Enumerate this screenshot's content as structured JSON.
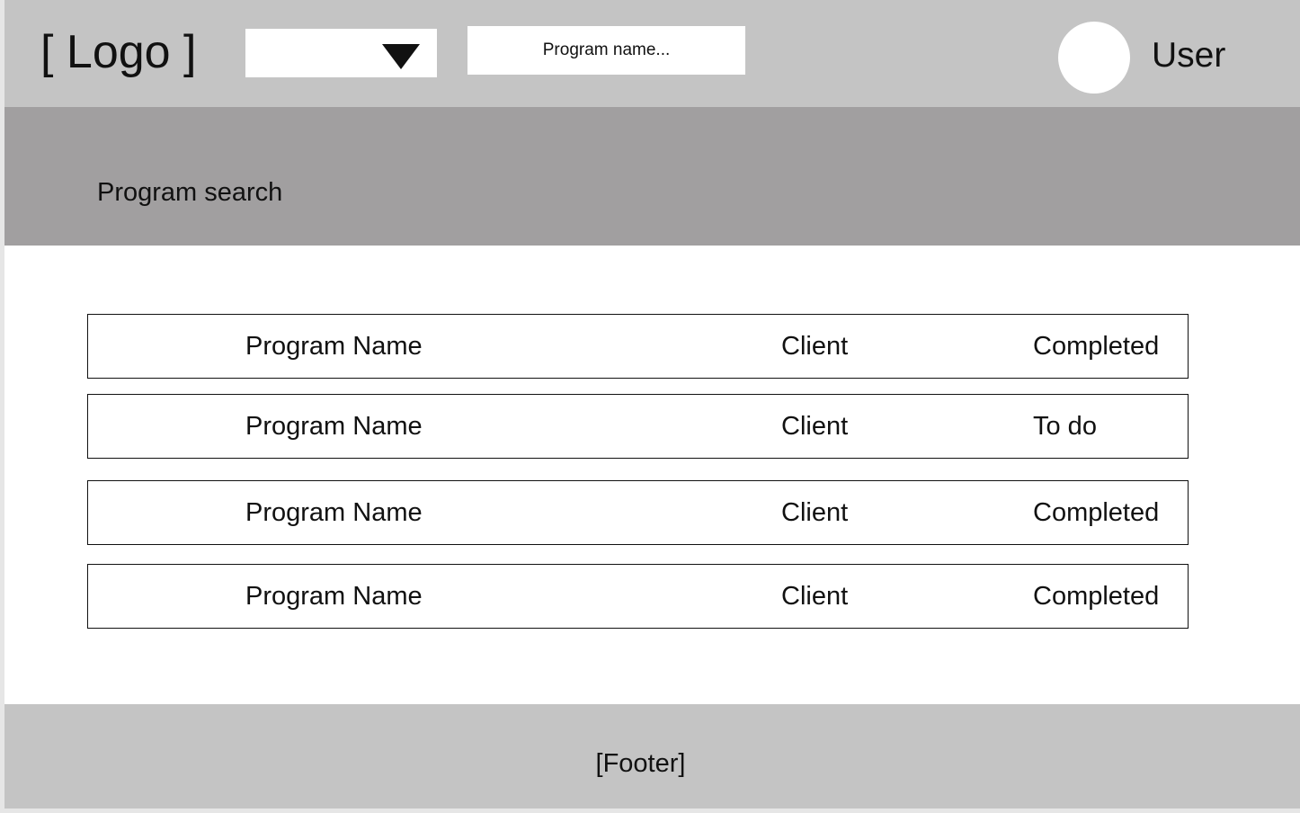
{
  "header": {
    "logo_text": "[ Logo ]",
    "program_select": {
      "selected_value": "",
      "icon": "caret-down-icon"
    },
    "search": {
      "placeholder": "Program name..."
    },
    "user": {
      "avatar_icon": "avatar-circle",
      "name": "User"
    }
  },
  "banner": {
    "title": "Program search"
  },
  "programs": [
    {
      "name": "Program Name",
      "client": "Client",
      "status": "Completed"
    },
    {
      "name": "Program Name",
      "client": "Client",
      "status": "To do"
    },
    {
      "name": "Program Name",
      "client": "Client",
      "status": "Completed"
    },
    {
      "name": "Program Name",
      "client": "Client",
      "status": "Completed"
    }
  ],
  "footer": {
    "text": "[Footer]"
  },
  "colors": {
    "header_bg": "#c4c4c4",
    "banner_bg": "#a19fa0",
    "footer_bg": "#c4c4c4",
    "text": "#111111",
    "row_border": "#111111"
  }
}
